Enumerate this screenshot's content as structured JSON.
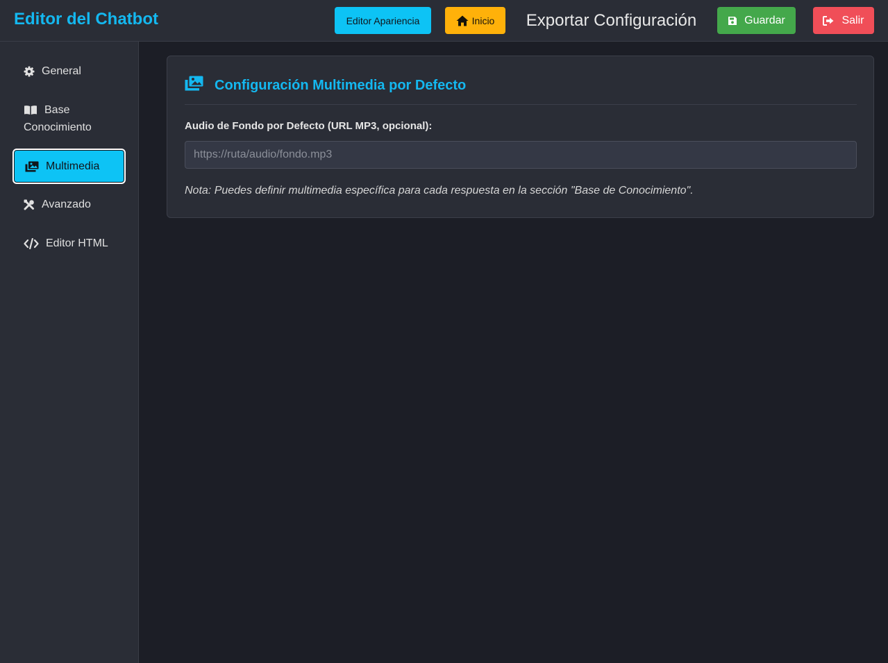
{
  "header": {
    "title": "Editor del Chatbot",
    "appearance_label": "Editor Apariencia",
    "home_label": "Inicio",
    "export_label": "Exportar Configuración",
    "save_label": "Guardar",
    "exit_label": "Salir"
  },
  "sidebar": {
    "items": [
      {
        "label": "General",
        "icon": "gear-icon"
      },
      {
        "label": "Base Conocimiento",
        "icon": "book-icon"
      },
      {
        "label": "Multimedia",
        "icon": "images-icon",
        "active": true
      },
      {
        "label": "Avanzado",
        "icon": "tools-icon"
      },
      {
        "label": "Editor HTML",
        "icon": "code-icon"
      }
    ]
  },
  "main": {
    "section_title": "Configuración Multimedia por Defecto",
    "section_icon": "images-icon",
    "audio_label": "Audio de Fondo por Defecto (URL MP3, opcional):",
    "audio_value": "",
    "audio_placeholder": "https://ruta/audio/fondo.mp3",
    "note": "Nota: Puedes definir multimedia específica para cada respuesta en la sección \"Base de Conocimiento\"."
  },
  "colors": {
    "accent": "#14b8f0",
    "appearance_button": "#0dc3f5",
    "home_button": "#ffb10a",
    "save_button": "#44a84b",
    "exit_button": "#f04e58",
    "background": "#1c1e26",
    "panel": "#2a2d36"
  }
}
